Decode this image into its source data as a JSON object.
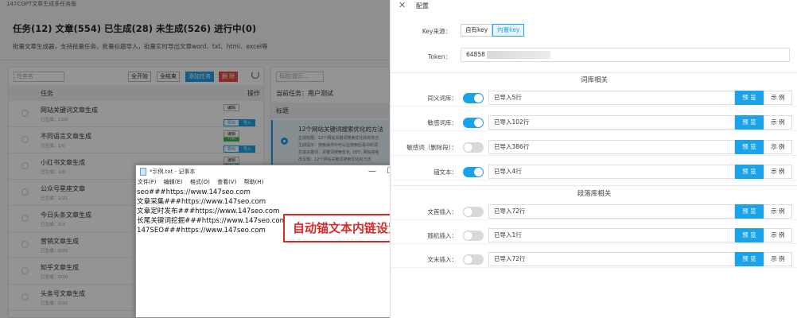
{
  "app": {
    "title": "147CGPT文章生成多任务版",
    "stats": "任务(12) 文章(554) 已生成(28) 未生成(526) 进行中(0)",
    "subtitle": "批量文章生成器，支持批量任务，批量标题导入，批量实时导出文章word、txt、html、excel等"
  },
  "task_toolbar": {
    "search_placeholder": "任务名",
    "start_all": "全开始",
    "end_all": "全结束",
    "add_task": "添加任务",
    "delete": "删 除"
  },
  "task_table": {
    "col_task": "任务",
    "col_ops": "操作",
    "op_edit": "编辑",
    "op_import": "导入",
    "op_export": "导出",
    "op_start": "开始",
    "rows": [
      {
        "name": "网站关键词文章生成",
        "sub": "已生成：13/0"
      },
      {
        "name": "不同语言文章生成",
        "sub": "已生成：1/0"
      },
      {
        "name": "小红书文章生成",
        "sub": "已生成：1/0"
      },
      {
        "name": "公众号星座文章",
        "sub": "已生成：1/21"
      },
      {
        "name": "今日头条文章生成",
        "sub": "已生成：0/3"
      },
      {
        "name": "营销文章生成",
        "sub": "已生成：0/20"
      },
      {
        "name": "知乎文章生成",
        "sub": "已生成：0/20"
      },
      {
        "name": "头条号文章生成",
        "sub": "已生成：0/20"
      }
    ]
  },
  "title_panel": {
    "search_placeholder": "标题/提示...",
    "current_task": "当前任务：用户测试",
    "header": "标题",
    "item": {
      "title": "12个网站关键词搜索优化的方法",
      "lines": [
        "生成标题：12个网站关键词搜索优化的有效方",
        "生成提示：搜索操作中可以在搜索后看中的词",
        "生成关键词：关键词搜索优化, SEO, 网站排名",
        "改写题：12个网站关键词搜索优化的方法"
      ]
    }
  },
  "notepad": {
    "title": "*示例.txt - 记事本",
    "menu": [
      "文件(F)",
      "编辑(E)",
      "格式(O)",
      "查看(V)",
      "帮助(H)"
    ],
    "minimize": "—",
    "maximize": "☐",
    "close": "✕",
    "content": "seo###https://www.147seo.com\n文章采集###https://www.147seo.com\n文章定时发布###https://www.147seo.com\n长尾关键词挖掘###https://www.147seo.com\n147SEO###https://www.147seo.com"
  },
  "callout": "自动锚文本内链设置",
  "config": {
    "close_icon": "✕",
    "title": "配置",
    "key_source_label": "Key来源：",
    "key_options": [
      "自有key",
      "内置key"
    ],
    "token_label": "Token：",
    "token_value": "64858",
    "section_lexicon": "词库相关",
    "section_paragraph": "段落库相关",
    "preview": "预 览",
    "example": "示 例",
    "lexicon_rows": [
      {
        "label": "同义词库：",
        "on": true,
        "status": "已导入5行"
      },
      {
        "label": "敏感词库：",
        "on": true,
        "status": "已导入102行"
      },
      {
        "label": "敏感词（删除段）：",
        "on": false,
        "status": "已导入386行"
      },
      {
        "label": "锚文本：",
        "on": true,
        "status": "已导入4行"
      }
    ],
    "paragraph_rows": [
      {
        "label": "文首插入：",
        "on": false,
        "status": "已导入72行"
      },
      {
        "label": "随机插入：",
        "on": false,
        "status": "已导入1行"
      },
      {
        "label": "文末插入：",
        "on": false,
        "status": "已导入72行"
      }
    ]
  },
  "colors": {
    "accent": "#1aa3e8",
    "annotation": "#d62a2a",
    "start_green": "#2db84d",
    "delete_red": "#e54d42"
  }
}
